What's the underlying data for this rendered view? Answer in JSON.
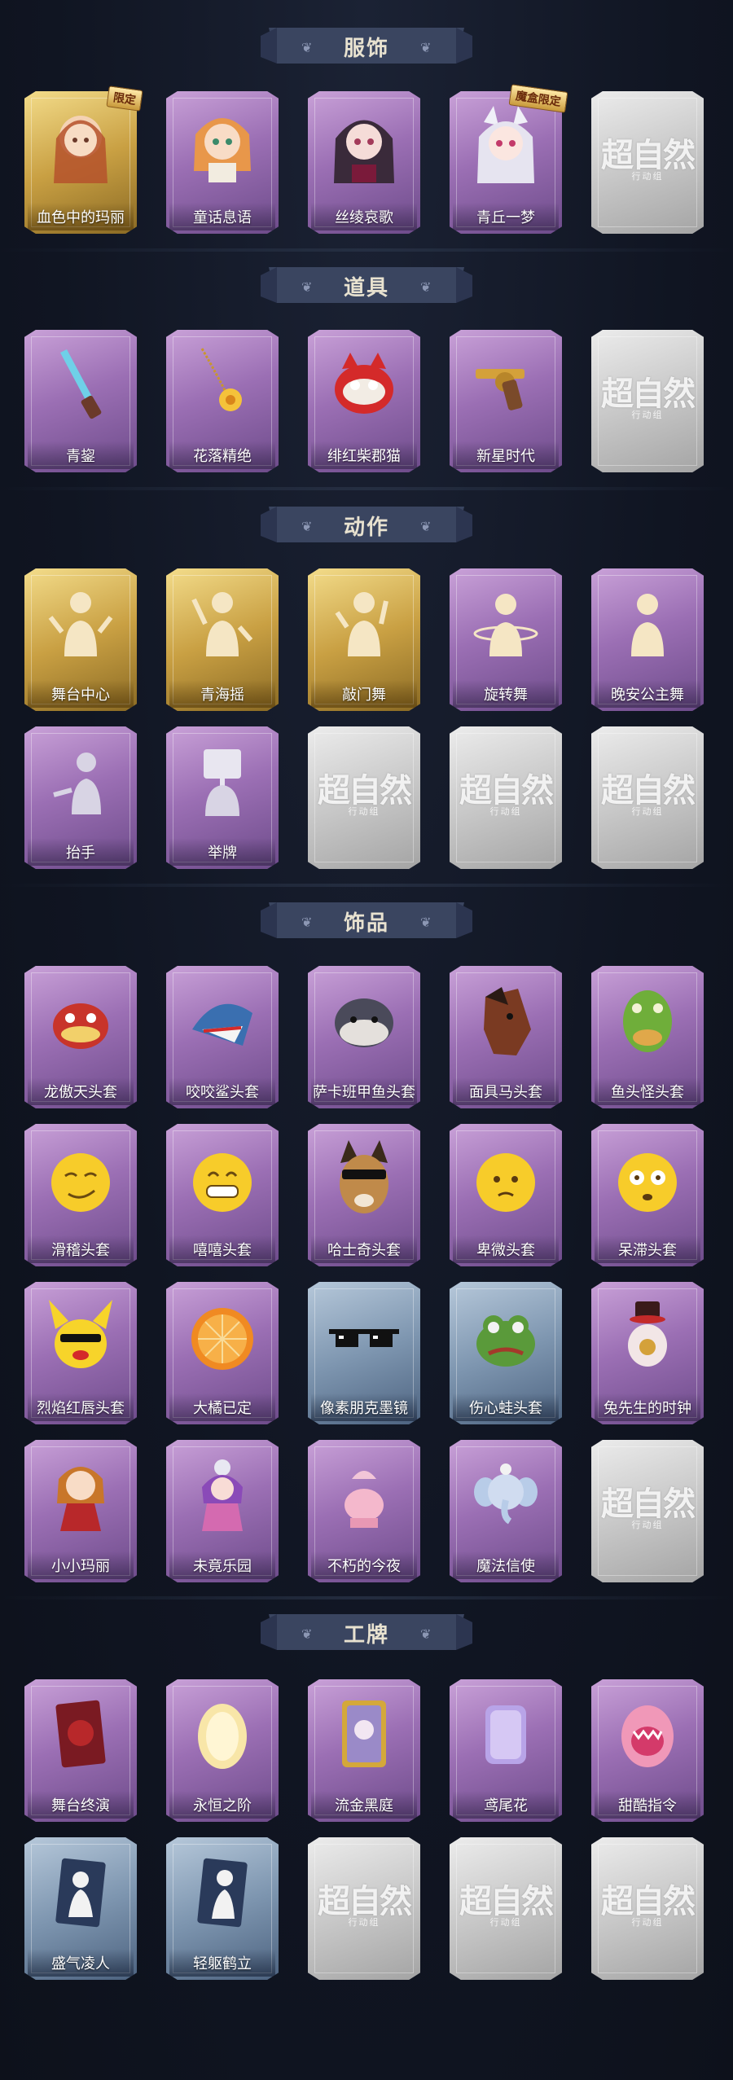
{
  "sections": {
    "clothing": {
      "title": "服饰",
      "items": [
        {
          "label": "血色中的玛丽",
          "tag": "限定"
        },
        {
          "label": "童话息语"
        },
        {
          "label": "丝绫哀歌"
        },
        {
          "label": "青丘一梦",
          "tag": "魔盒限定"
        }
      ]
    },
    "props": {
      "title": "道具",
      "items": [
        {
          "label": "青鋆"
        },
        {
          "label": "花落精绝"
        },
        {
          "label": "绯红柴郡猫"
        },
        {
          "label": "新星时代"
        }
      ]
    },
    "actions": {
      "title": "动作",
      "items": [
        {
          "label": "舞台中心"
        },
        {
          "label": "青海摇"
        },
        {
          "label": "敲门舞"
        },
        {
          "label": "旋转舞"
        },
        {
          "label": "晚安公主舞"
        },
        {
          "label": "抬手"
        },
        {
          "label": "举牌"
        }
      ]
    },
    "accessories": {
      "title": "饰品",
      "items": [
        {
          "label": "龙傲天头套"
        },
        {
          "label": "咬咬鲨头套"
        },
        {
          "label": "萨卡班甲鱼头套"
        },
        {
          "label": "面具马头套"
        },
        {
          "label": "鱼头怪头套"
        },
        {
          "label": "滑稽头套"
        },
        {
          "label": "嘻嘻头套"
        },
        {
          "label": "哈士奇头套"
        },
        {
          "label": "卑微头套"
        },
        {
          "label": "呆滞头套"
        },
        {
          "label": "烈焰红唇头套"
        },
        {
          "label": "大橘已定"
        },
        {
          "label": "像素朋克墨镜"
        },
        {
          "label": "伤心蛙头套"
        },
        {
          "label": "兔先生的时钟"
        },
        {
          "label": "小小玛丽"
        },
        {
          "label": "未竟乐园"
        },
        {
          "label": "不朽的今夜"
        },
        {
          "label": "魔法信使"
        }
      ]
    },
    "badges": {
      "title": "工牌",
      "items": [
        {
          "label": "舞台终演"
        },
        {
          "label": "永恒之阶"
        },
        {
          "label": "流金黑庭"
        },
        {
          "label": "鸢尾花"
        },
        {
          "label": "甜酷指令"
        },
        {
          "label": "盛气凌人"
        },
        {
          "label": "轻躯鹤立"
        }
      ]
    }
  },
  "placeholder": {
    "title": "超自然",
    "subtitle": "行动组"
  }
}
